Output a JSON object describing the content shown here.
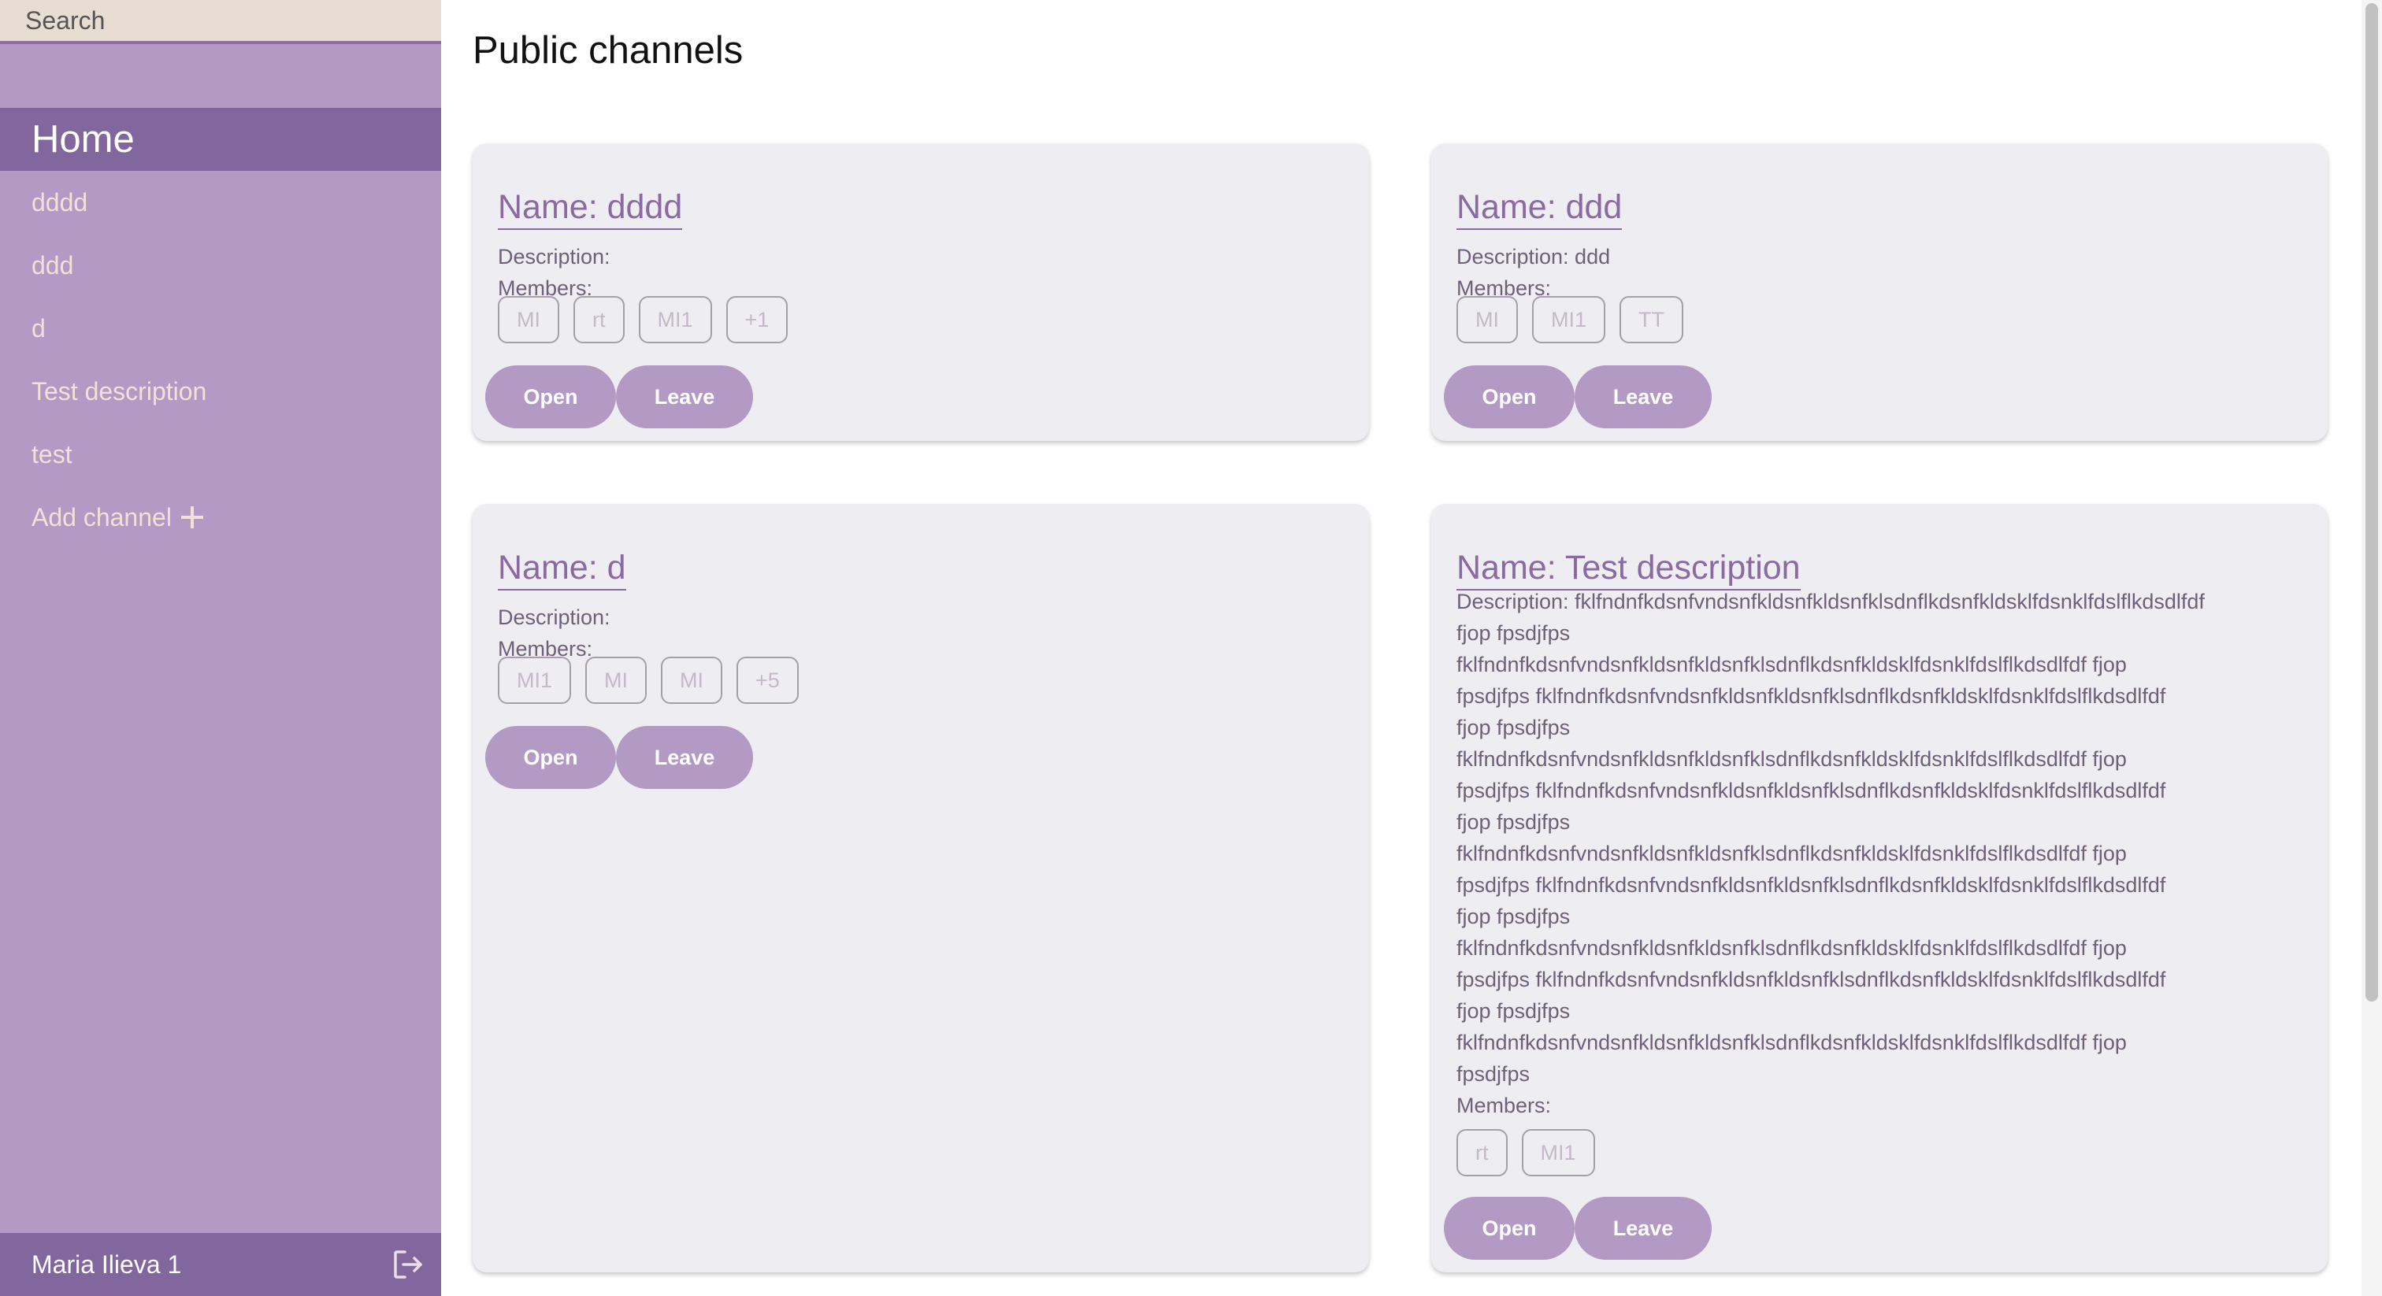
{
  "search": {
    "placeholder": "Search"
  },
  "sidebar": {
    "home_label": "Home",
    "channels": [
      "dddd",
      "ddd",
      "d",
      "Test description",
      "test"
    ],
    "add_channel_label": "Add channel"
  },
  "user": {
    "name": "Maria Ilieva 1"
  },
  "main": {
    "title": "Public channels"
  },
  "cards": [
    {
      "name": "Name: dddd",
      "description": "Description:",
      "members_label": "Members:",
      "members": [
        "MI",
        "rt",
        "MI1",
        "+1"
      ],
      "open_label": "Open",
      "leave_label": "Leave"
    },
    {
      "name": "Name: ddd",
      "description": "Description: ddd",
      "members_label": "Members:",
      "members": [
        "MI",
        "MI1",
        "TT"
      ],
      "open_label": "Open",
      "leave_label": "Leave"
    },
    {
      "name": "Name: d",
      "description": "Description:",
      "members_label": "Members:",
      "members": [
        "MI1",
        "MI",
        "MI",
        "+5"
      ],
      "open_label": "Open",
      "leave_label": "Leave"
    },
    {
      "name": "Name: Test description",
      "description_lines": [
        "Description: fklfndnfkdsnfvndsnfkldsnfkldsnfklsdnflkdsnfkldsklfdsnklfdslflkdsdlfdf",
        "fjop fpsdjfps",
        "fklfndnfkdsnfvndsnfkldsnfkldsnfklsdnflkdsnfkldsklfdsnklfdslflkdsdlfdf fjop",
        "fpsdjfps fklfndnfkdsnfvndsnfkldsnfkldsnfklsdnflkdsnfkldsklfdsnklfdslflkdsdlfdf",
        "fjop fpsdjfps",
        "fklfndnfkdsnfvndsnfkldsnfkldsnfklsdnflkdsnfkldsklfdsnklfdslflkdsdlfdf fjop",
        "fpsdjfps fklfndnfkdsnfvndsnfkldsnfkldsnfklsdnflkdsnfkldsklfdsnklfdslflkdsdlfdf",
        "fjop fpsdjfps",
        "fklfndnfkdsnfvndsnfkldsnfkldsnfklsdnflkdsnfkldsklfdsnklfdslflkdsdlfdf fjop",
        "fpsdjfps fklfndnfkdsnfvndsnfkldsnfkldsnfklsdnflkdsnfkldsklfdsnklfdslflkdsdlfdf",
        "fjop fpsdjfps",
        "fklfndnfkdsnfvndsnfkldsnfkldsnfklsdnflkdsnfkldsklfdsnklfdslflkdsdlfdf fjop",
        "fpsdjfps fklfndnfkdsnfvndsnfkldsnfkldsnfklsdnflkdsnfkldsklfdsnklfdslflkdsdlfdf",
        "fjop fpsdjfps",
        "fklfndnfkdsnfvndsnfkldsnfkldsnfklsdnflkdsnfkldsklfdsnklfdslflkdsdlfdf fjop",
        "fpsdjfps"
      ],
      "members_label": "Members:",
      "members": [
        "rt",
        "MI1"
      ],
      "open_label": "Open",
      "leave_label": "Leave"
    }
  ],
  "colors": {
    "sidebar_bg": "#b39ac5",
    "sidebar_active": "#82669e",
    "sidebar_text": "#f0e2d6",
    "card_bg": "#eeedf2",
    "accent": "#8a6aa1"
  },
  "icons": {
    "add": "plus-icon",
    "logout": "logout-icon"
  }
}
